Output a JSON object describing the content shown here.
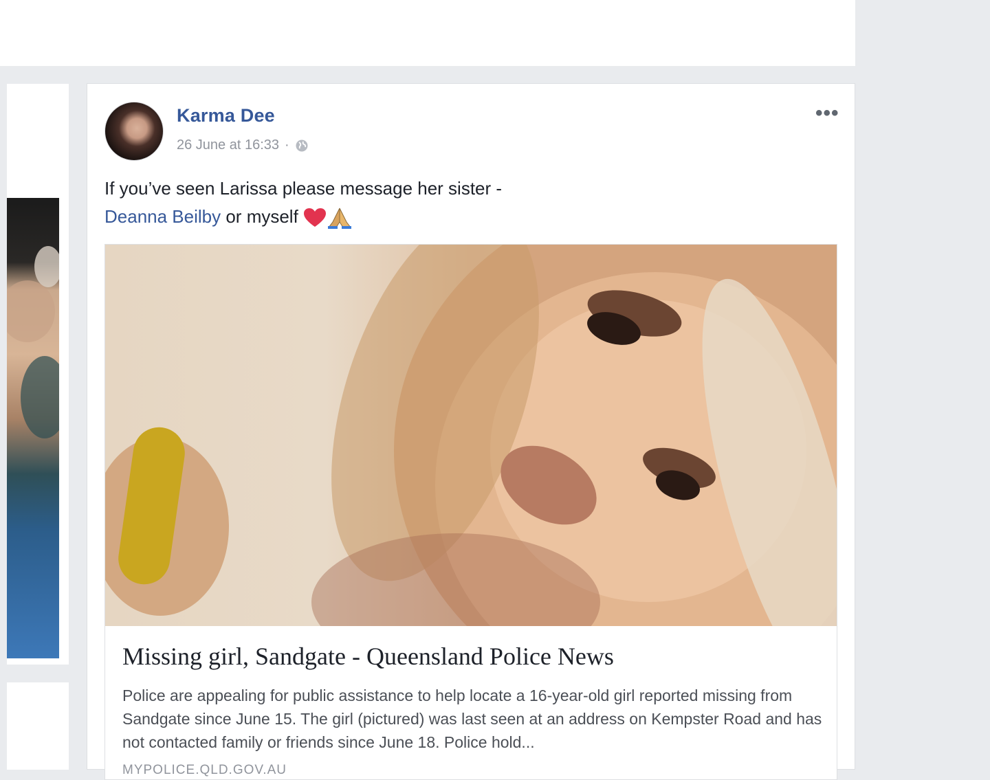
{
  "post": {
    "author": "Karma Dee",
    "timestamp": "26 June at 16:33",
    "separator": "·",
    "more_label": "•••",
    "text_line1": "If you’ve seen Larissa please message her sister -",
    "mention": "Deanna Beilby",
    "text_line2_rest": " or myself ",
    "icons": {
      "privacy": "globe-icon",
      "menu": "more-options-icon",
      "emoji1": "red-heart-icon",
      "emoji2": "folded-hands-icon"
    }
  },
  "link_preview": {
    "title": "Missing girl, Sandgate - Queensland Police News",
    "description": "Police are appealing for public assistance to help locate a 16-year-old girl reported missing from Sandgate since June 15. The girl (pictured) was last seen at an address on Kempster Road and has not contacted family or friends since June 18. Police hold...",
    "domain": "MYPOLICE.QLD.GOV.AU"
  },
  "colors": {
    "name_link": "#365899",
    "body_text": "#1d2129",
    "meta_text": "#90949c",
    "feed_background": "#e9ebee",
    "card_border": "#dddfe2"
  }
}
